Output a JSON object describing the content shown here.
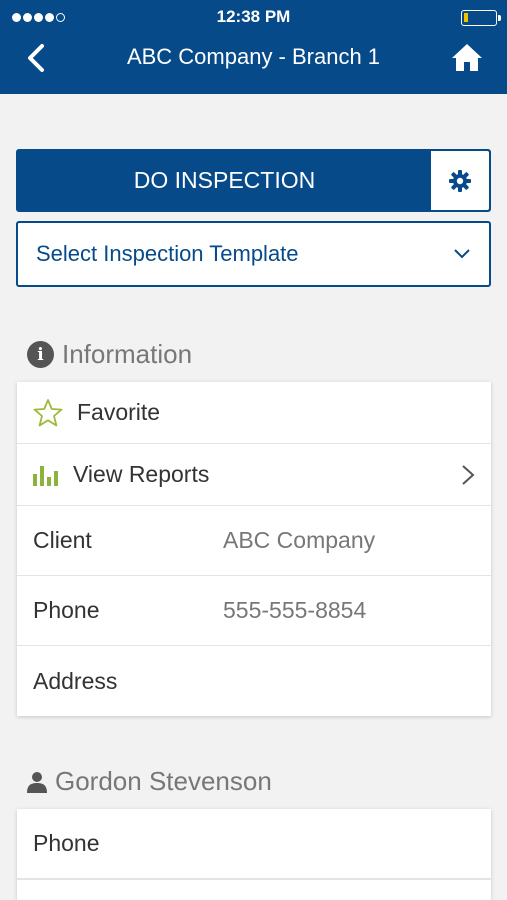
{
  "status_bar": {
    "time": "12:38 PM"
  },
  "header": {
    "title": "ABC Company - Branch 1"
  },
  "actions": {
    "inspect_label": "DO INSPECTION",
    "template_placeholder": "Select Inspection Template"
  },
  "information": {
    "heading": "Information",
    "favorite_label": "Favorite",
    "view_reports_label": "View Reports",
    "fields": [
      {
        "label": "Client",
        "value": "ABC Company"
      },
      {
        "label": "Phone",
        "value": "555-555-8854"
      },
      {
        "label": "Address",
        "value": ""
      }
    ]
  },
  "contact": {
    "name": "Gordon Stevenson",
    "fields": [
      {
        "label": "Phone",
        "value": ""
      }
    ]
  },
  "colors": {
    "brand": "#064a8a",
    "favorite_star": "#9dbb3a",
    "reports_icon": "#8cb43c",
    "battery": "#f2c200"
  },
  "icons": [
    "back-chevron-icon",
    "home-icon",
    "gear-icon",
    "chevron-down-icon",
    "info-icon",
    "star-outline-icon",
    "bar-chart-icon",
    "chevron-right-icon",
    "person-icon"
  ]
}
